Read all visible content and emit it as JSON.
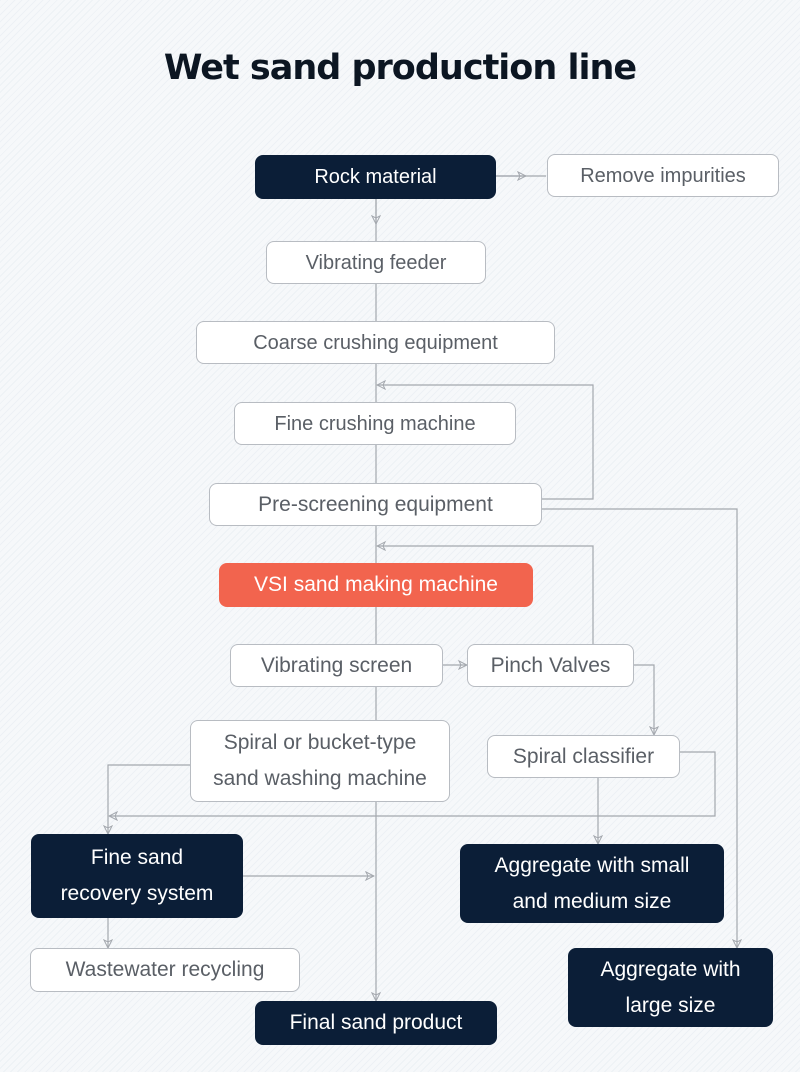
{
  "title": "Wet sand production line",
  "colors": {
    "dark_node": "#0b1e37",
    "accent_node": "#f2644e",
    "light_node_border": "#b8bcc2",
    "connector": "#a4a8ae",
    "title": "#0c1622"
  },
  "nodes": {
    "rock_material": "Rock material",
    "remove_impurities": "Remove impurities",
    "vibrating_feeder": "Vibrating feeder",
    "coarse_crushing": "Coarse crushing equipment",
    "fine_crushing": "Fine crushing machine",
    "pre_screening": "Pre-screening equipment",
    "vsi": "VSI sand making machine",
    "vibrating_screen": "Vibrating screen",
    "pinch_valves": "Pinch Valves",
    "sand_washing": "Spiral or bucket-type\nsand washing machine",
    "spiral_classifier": "Spiral classifier",
    "fine_sand_recovery": "Fine sand\nrecovery system",
    "aggregate_small_medium": "Aggregate with small\nand medium size",
    "wastewater": "Wastewater recycling",
    "aggregate_large": "Aggregate with\nlarge size",
    "final_sand": "Final sand product"
  },
  "edges": [
    {
      "from": "rock_material",
      "to": "remove_impurities"
    },
    {
      "from": "rock_material",
      "to": "vibrating_feeder"
    },
    {
      "from": "vibrating_feeder",
      "to": "coarse_crushing"
    },
    {
      "from": "coarse_crushing",
      "to": "fine_crushing"
    },
    {
      "from": "fine_crushing",
      "to": "pre_screening"
    },
    {
      "from": "pre_screening",
      "to": "fine_crushing",
      "type": "return"
    },
    {
      "from": "pre_screening",
      "to": "aggregate_large"
    },
    {
      "from": "pre_screening",
      "to": "vsi"
    },
    {
      "from": "vsi",
      "to": "vibrating_screen"
    },
    {
      "from": "vibrating_screen",
      "to": "pinch_valves"
    },
    {
      "from": "pinch_valves",
      "to": "vsi",
      "type": "return"
    },
    {
      "from": "pinch_valves",
      "to": "spiral_classifier"
    },
    {
      "from": "vibrating_screen",
      "to": "sand_washing"
    },
    {
      "from": "sand_washing",
      "to": "fine_sand_recovery"
    },
    {
      "from": "spiral_classifier",
      "to": "fine_sand_recovery"
    },
    {
      "from": "spiral_classifier",
      "to": "aggregate_small_medium"
    },
    {
      "from": "fine_sand_recovery",
      "to": "final_sand"
    },
    {
      "from": "fine_sand_recovery",
      "to": "wastewater"
    },
    {
      "from": "sand_washing",
      "to": "final_sand"
    }
  ]
}
